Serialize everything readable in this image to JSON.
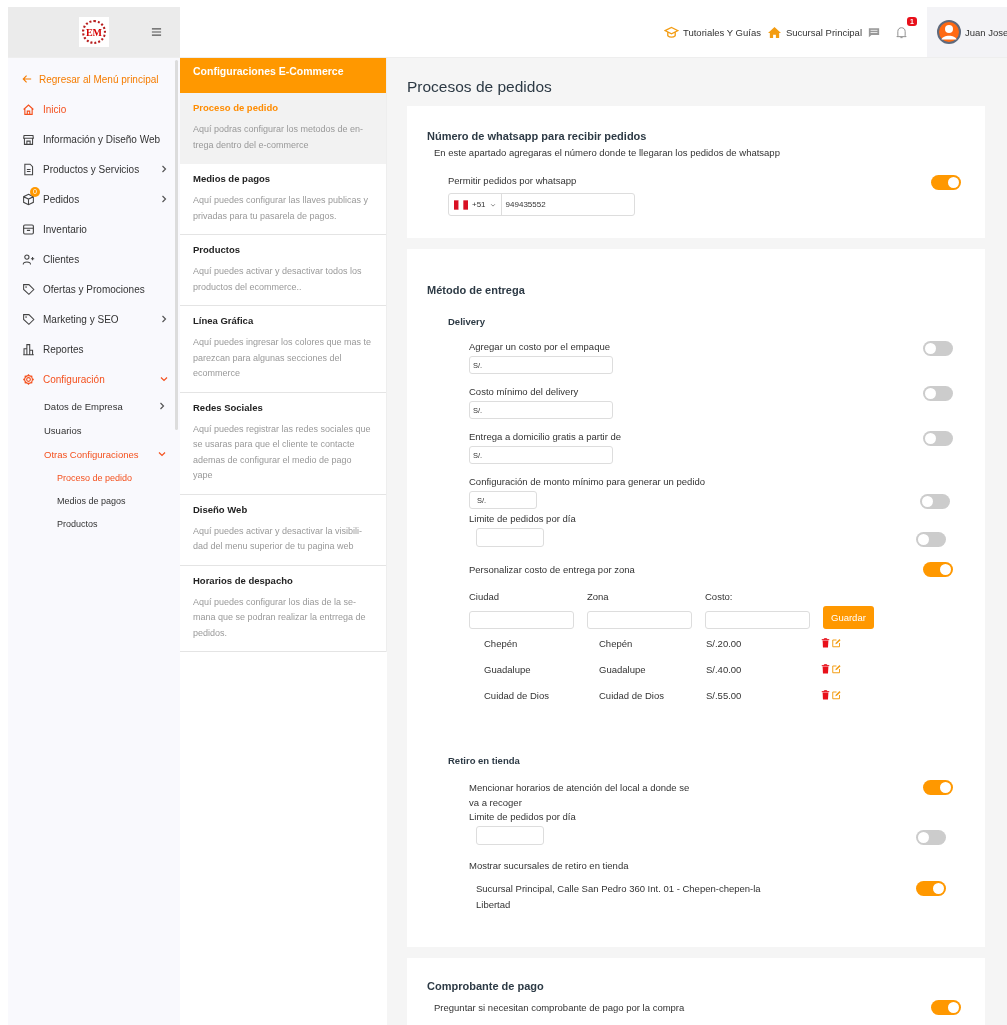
{
  "topbar": {
    "logo": "EM",
    "links": [
      {
        "label": "Tutoriales Y Guías",
        "kind": "cap"
      },
      {
        "label": "Sucursal Principal",
        "kind": "home"
      }
    ],
    "notification_count": "1",
    "user": "Juan Jose"
  },
  "sidebar": {
    "back_link": "Regresar al Menú principal",
    "items": [
      {
        "label": "Inicio",
        "kind": "home",
        "active": true
      },
      {
        "label": "Información y Diseño Web",
        "kind": "store",
        "active": false
      },
      {
        "label": "Productos y Servicios",
        "kind": "doc",
        "active": false,
        "expanded": false
      },
      {
        "label": "Pedidos",
        "kind": "box",
        "active": false,
        "expanded": false,
        "badge": "0"
      },
      {
        "label": "Inventario",
        "kind": "archive",
        "active": false
      },
      {
        "label": "Clientes",
        "kind": "user-plus",
        "active": false
      },
      {
        "label": "Ofertas y Promociones",
        "kind": "tag",
        "active": false
      },
      {
        "label": "Marketing y SEO",
        "kind": "tag",
        "active": false,
        "expanded": false
      },
      {
        "label": "Reportes",
        "kind": "chart",
        "active": false
      },
      {
        "label": "Configuración",
        "kind": "gear",
        "active": true,
        "expanded": true,
        "children": [
          {
            "label": "Datos de Empresa",
            "active": false,
            "expanded": false
          },
          {
            "label": "Usuarios",
            "active": false
          },
          {
            "label": "Otras Configuraciones",
            "active": true,
            "expanded": true,
            "children": [
              {
                "label": "Proceso de pedido",
                "selected": true
              },
              {
                "label": "Medios de pagos",
                "selected": false
              },
              {
                "label": "Productos",
                "selected": false
              }
            ]
          }
        ]
      }
    ]
  },
  "config_panel": {
    "title": "Configuraciones E-Commerce",
    "items": [
      {
        "title": "Proceso de pedido",
        "description": "Aquí podras configurar los metodos de en-trega dentro del e-commerce",
        "selected": true
      },
      {
        "title": "Medios de pagos",
        "description": "Aquí puedes configurar las llaves publicas y privadas para tu pasarela de pagos.",
        "selected": false
      },
      {
        "title": "Productos",
        "description": "Aquí puedes activar y desactivar todos los productos del ecommerce..",
        "selected": false
      },
      {
        "title": "Línea Gráfica",
        "description": "Aquí puedes ingresar los colores que mas te parezcan para algunas secciones del ecommerce",
        "selected": false
      },
      {
        "title": "Redes Sociales",
        "description": "Aquí puedes registrar las redes sociales que se usaras para que el cliente te contacte ademas de configurar el medio de pago yape",
        "selected": false
      },
      {
        "title": "Diseño Web",
        "description": "Aquí puedes activar y desactivar la visibili-dad del menu superior de tu pagina web",
        "selected": false
      },
      {
        "title": "Horarios de despacho",
        "description": "Aquí puedes configurar los dias de la se-mana que se podran realizar la entrrega de pedidos.",
        "selected": false
      }
    ]
  },
  "main": {
    "title": "Procesos de pedidos",
    "whatsapp": {
      "title": "Número de whatsapp para recibir pedidos",
      "description": "En este apartado agregaras el número donde te llegaran los pedidos de whatsapp",
      "toggle_label": "Permitir pedidos por whatsapp",
      "on": true,
      "country_code": "+51",
      "phone": "949435552"
    },
    "delivery_method": {
      "title": "Método de entrega",
      "groups": [
        {
          "title": "Delivery",
          "options": [
            {
              "kind": "money",
              "label": "Agregar un costo por el empaque",
              "on": false,
              "value": "S/."
            },
            {
              "kind": "money",
              "label": "Costo mínimo del delivery",
              "on": false,
              "value": "S/."
            },
            {
              "kind": "money",
              "label": "Entrega a domicilio gratis a partir de",
              "on": false,
              "value": "S/."
            },
            {
              "kind": "money-short",
              "label": "Configuración de monto mínimo para generar un pedido",
              "on": false,
              "value": "S/."
            },
            {
              "kind": "count",
              "label": "Limite de pedidos por día",
              "on": false
            },
            {
              "kind": "zones",
              "label": "Personalizar costo de entrega por zona",
              "on": true,
              "columns": [
                "Ciudad",
                "Zona",
                "Costo:"
              ],
              "button": "Guardar",
              "rows": [
                {
                  "city": "Chepén",
                  "zone": "Chepén",
                  "cost": "S/.20.00"
                },
                {
                  "city": "Guadalupe",
                  "zone": "Guadalupe",
                  "cost": "S/.40.00"
                },
                {
                  "city": "Cuidad de Dios",
                  "zone": "Cuidad de Dios",
                  "cost": "S/.55.00"
                }
              ]
            }
          ]
        },
        {
          "title": "Retiro en tienda",
          "options": [
            {
              "kind": "plain",
              "label": "Mencionar horarios de atención del local a donde se va a recoger",
              "on": true
            },
            {
              "kind": "count",
              "label": "Limite de pedidos por día",
              "on": false
            },
            {
              "kind": "branches",
              "label": "Mostrar sucursales de retiro en tienda",
              "branches": [
                {
                  "label": "Sucursal Principal, Calle San Pedro 360 Int. 01 - Chepen-chepen-la Libertad",
                  "on": true
                }
              ]
            }
          ]
        }
      ]
    },
    "receipt": {
      "title": "Comprobante de pago",
      "option": "Preguntar si necesitan comprobante de pago por la compra",
      "on": true
    }
  }
}
